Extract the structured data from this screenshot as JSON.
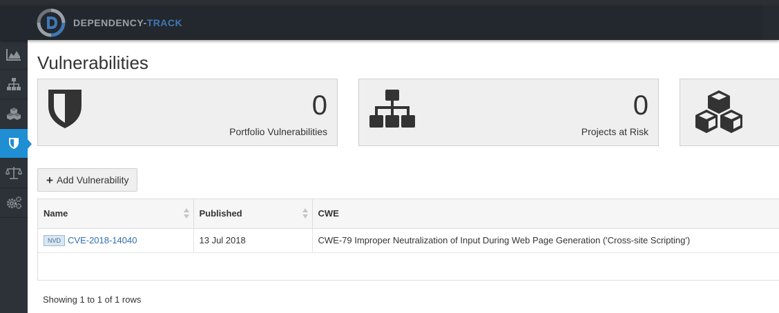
{
  "header": {
    "brand_part1": "DEPENDENCY-",
    "brand_part2": "TRACK",
    "accent": "#3f78b5"
  },
  "sidebar": {
    "items": [
      {
        "icon": "area-chart-icon",
        "active": false
      },
      {
        "icon": "sitemap-icon",
        "active": false
      },
      {
        "icon": "cubes-icon",
        "active": false
      },
      {
        "icon": "shield-icon",
        "active": true
      },
      {
        "icon": "balance-scale-icon",
        "active": false
      },
      {
        "icon": "cogs-icon",
        "active": false
      }
    ],
    "active_color": "#1f8ed3"
  },
  "main": {
    "title": "Vulnerabilities",
    "cards": [
      {
        "icon": "shield-icon",
        "count": "0",
        "label": "Portfolio Vulnerabilities"
      },
      {
        "icon": "sitemap-icon",
        "count": "0",
        "label": "Projects at Risk"
      },
      {
        "icon": "cubes-icon",
        "count": "",
        "label": ""
      }
    ],
    "add_button": {
      "icon": "plus-icon",
      "label": "Add Vulnerability"
    },
    "table": {
      "columns": [
        "Name",
        "Published",
        "CWE"
      ],
      "rows": [
        {
          "source": "NVD",
          "name": "CVE-2018-14040",
          "published": "13 Jul 2018",
          "cwe": "CWE-79 Improper Neutralization of Input During Web Page Generation ('Cross-site Scripting')"
        }
      ]
    },
    "pagination_text": "Showing 1 to 1 of 1 rows"
  }
}
